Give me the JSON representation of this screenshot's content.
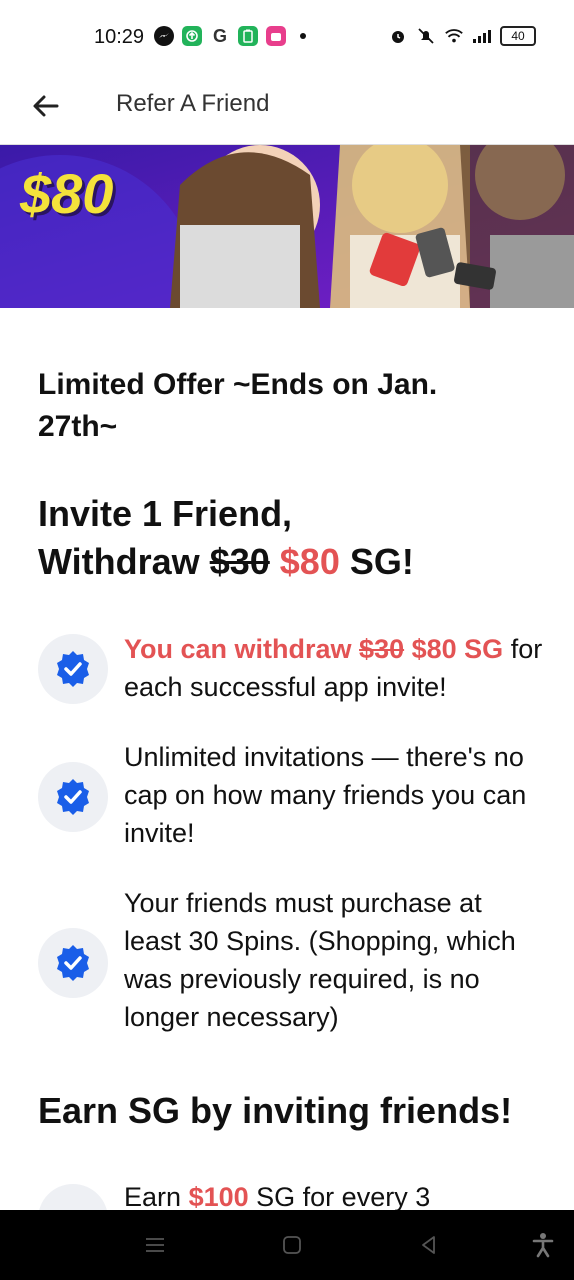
{
  "status_bar": {
    "time": "10:29",
    "battery": "40",
    "left_icons": [
      "messenger-icon",
      "app-update-icon",
      "google-icon",
      "battery-saver-icon",
      "shop-app-icon"
    ],
    "right_icons": [
      "alarm-icon",
      "mute-icon",
      "wifi-icon",
      "signal-icon"
    ]
  },
  "app_bar": {
    "title": "Refer A Friend",
    "back_icon": "back-arrow-icon"
  },
  "banner": {
    "amount": "$80"
  },
  "offer": {
    "text": "Limited Offer ~Ends on Jan. 27th~"
  },
  "headline": {
    "line1": "Invite 1 Friend,",
    "withdraw_prefix": "Withdraw",
    "old_amount": "$30",
    "new_amount": "$80",
    "suffix": "SG!"
  },
  "benefits": [
    {
      "red_prefix": "You can withdraw",
      "old_amount": "$30",
      "new_amount": "$80 SG",
      "text": "for each successful app invite!"
    },
    {
      "text": "Unlimited invitations — there's no cap on how many friends you can invite!"
    },
    {
      "text": "Your friends must purchase at least 30 Spins. (Shopping, which was previously required, is no longer necessary)"
    }
  ],
  "earn_section": {
    "title": "Earn SG by inviting friends!",
    "partial_prefix": "Earn",
    "partial_amount": "$100",
    "partial_suffix": "SG for every 3"
  },
  "colors": {
    "accent_red": "#e35354",
    "check_blue": "#1a5ee8",
    "check_bg": "#eef0f4"
  },
  "nav_bar": {
    "buttons": [
      "menu-icon",
      "home-icon",
      "back-icon",
      "accessibility-icon"
    ]
  }
}
